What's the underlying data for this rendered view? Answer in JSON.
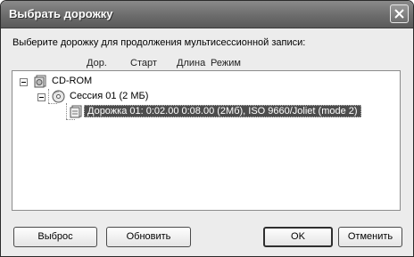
{
  "window": {
    "title": "Выбрать дорожку"
  },
  "prompt": "Выберите дорожку для продолжения мультисессионной записи:",
  "columns": {
    "track": "Дор.",
    "start": "Старт",
    "length": "Длина",
    "mode": "Режим"
  },
  "tree": {
    "root": {
      "label": "CD-ROM",
      "icon": "cd-drive-icon"
    },
    "session": {
      "label": "Сессия 01 (2 МБ)",
      "icon": "cd-disc-icon"
    },
    "track": {
      "label": "Дорожка 01:  0:02.00   0:08.00   (2Мб),   ISO 9660/Joliet (mode 2)",
      "icon": "track-file-icon",
      "selected": true
    }
  },
  "buttons": {
    "reset": "Выброс",
    "refresh": "Обновить",
    "ok": "OK",
    "cancel": "Отменить"
  },
  "colors": {
    "titlebar": "#6c6c6c",
    "selection": "#4d4d4d"
  }
}
